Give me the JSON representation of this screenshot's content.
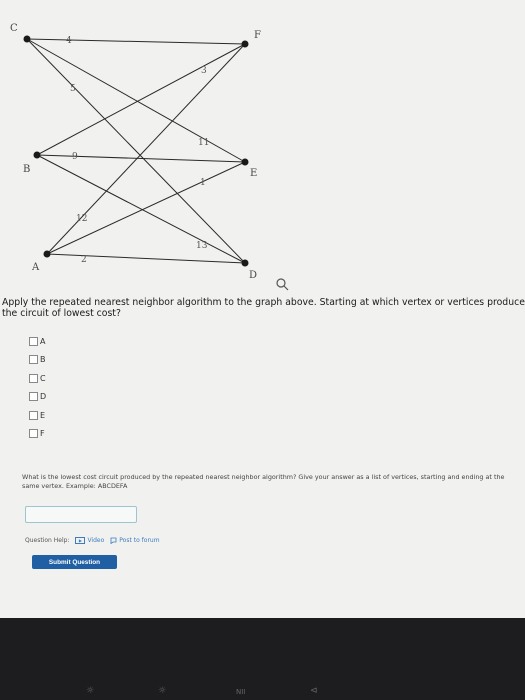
{
  "graph": {
    "vertices": {
      "A": "A",
      "B": "B",
      "C": "C",
      "D": "D",
      "E": "E",
      "F": "F"
    },
    "weights": {
      "CF": "4",
      "CE": "5",
      "AF": "12",
      "BE": "9",
      "BF": "3",
      "AE": "1",
      "CD": "11",
      "BD": "13",
      "AD": "2"
    }
  },
  "question1": "Apply the repeated nearest neighbor algorithm to the graph above. Starting at which vertex or vertices produces the circuit of lowest cost?",
  "options": [
    "A",
    "B",
    "C",
    "D",
    "E",
    "F"
  ],
  "question2": "What is the lowest cost circuit produced by the repeated nearest neighbor algorithm? Give your answer as a list of vertices, starting and ending at the same vertex. Example: ABCDEFA",
  "answer_value": "",
  "help": {
    "label": "Question Help:",
    "video": "Video",
    "forum": "Post to forum"
  },
  "submit_label": "Submit Question",
  "bezel_keys": [
    "☼",
    "☼",
    "ΝΙΙ",
    "⊲"
  ]
}
